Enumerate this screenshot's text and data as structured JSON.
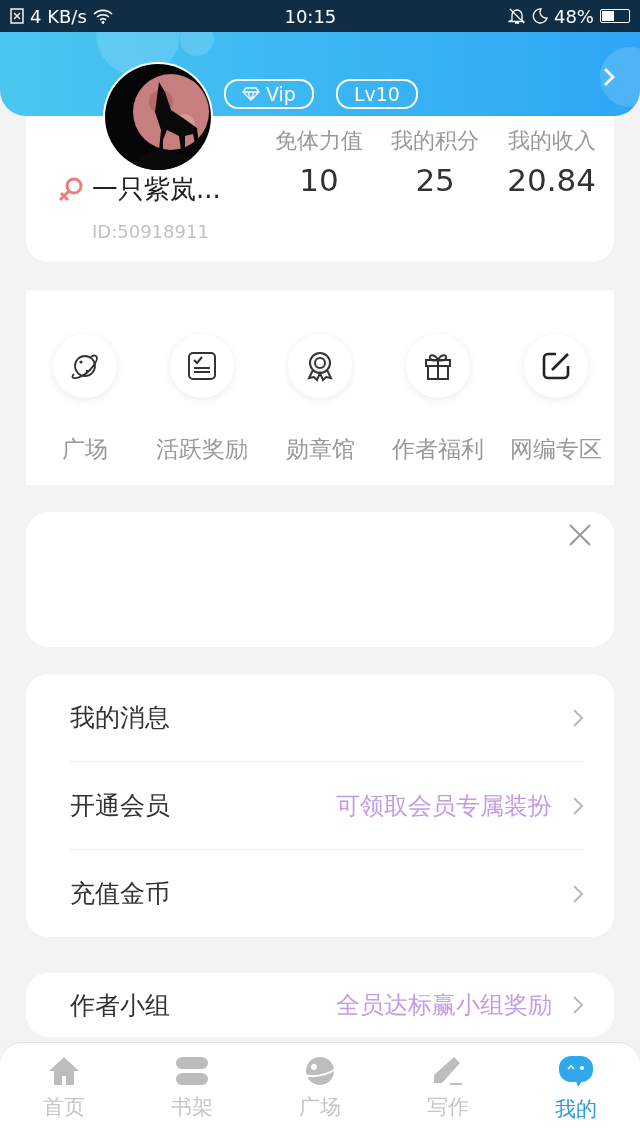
{
  "status_bar": {
    "speed": "4 KB/s",
    "time": "10:15",
    "battery": "48%"
  },
  "profile": {
    "badges": [
      "Vip",
      "Lv10"
    ],
    "name": "一只紫岚...",
    "user_id": "ID:50918911",
    "avatar": {
      "kind": "picture"
    },
    "stats": [
      {
        "label": "免体力值",
        "value": "10"
      },
      {
        "label": "我的积分",
        "value": "25"
      },
      {
        "label": "我的收入",
        "value": "20.84"
      }
    ]
  },
  "shortcuts": [
    {
      "label": "广场"
    },
    {
      "label": "活跃奖励"
    },
    {
      "label": "勋章馆"
    },
    {
      "label": "作者福利"
    },
    {
      "label": "网编专区"
    }
  ],
  "menu": [
    {
      "label": "我的消息"
    },
    {
      "label": "开通会员",
      "hint": "可领取会员专属装扮"
    },
    {
      "label": "充值金币"
    }
  ],
  "menu_2": [
    {
      "label": "作者小组",
      "hint": "全员达标赢小组奖励"
    }
  ],
  "tab_bar": [
    {
      "label": "首页",
      "selected": false
    },
    {
      "label": "书架",
      "selected": false
    },
    {
      "label": "广场",
      "selected": false
    },
    {
      "label": "写作",
      "selected": false
    },
    {
      "label": "我的",
      "selected": true
    }
  ]
}
